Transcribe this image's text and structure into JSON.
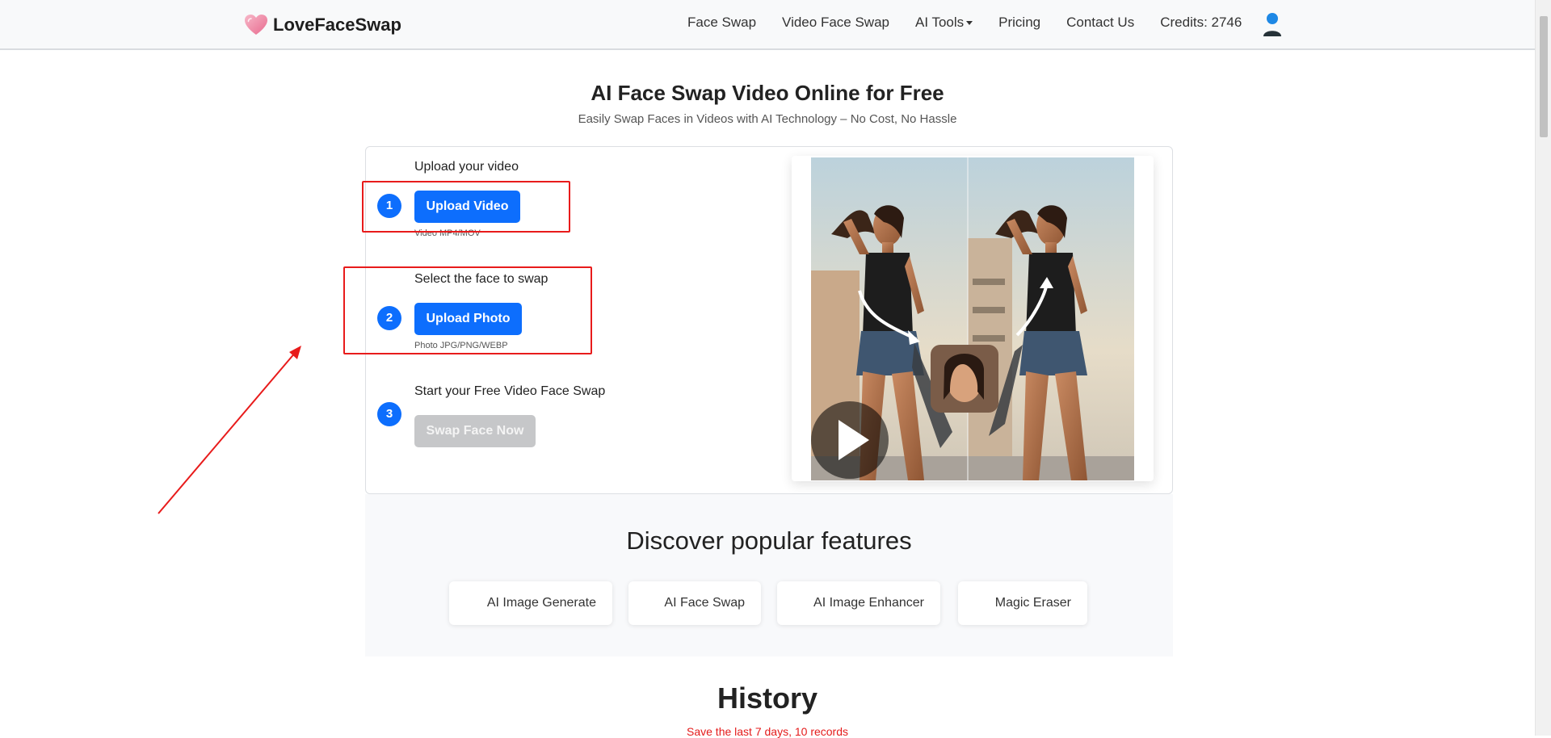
{
  "nav": {
    "brand": "LoveFaceSwap",
    "links": [
      "Face Swap",
      "Video Face Swap",
      "AI Tools",
      "Pricing",
      "Contact Us",
      "Credits: 2746"
    ],
    "user_icon": "user-icon"
  },
  "hero": {
    "title": "AI Face Swap Video Online for Free",
    "subtitle": "Easily Swap Faces in Videos with AI Technology – No Cost, No Hassle"
  },
  "steps": [
    {
      "number": "1",
      "label": "Upload your video",
      "button": "Upload Video",
      "hint": "Video MP4/MOV"
    },
    {
      "number": "2",
      "label": "Select the face to swap",
      "button": "Upload Photo",
      "hint": "Photo JPG/PNG/WEBP"
    },
    {
      "number": "3",
      "label": "Start your Free Video Face Swap",
      "button": "Swap Face Now"
    }
  ],
  "discover": {
    "title": "Discover popular features",
    "features": [
      "AI Image Generate",
      "AI Face Swap",
      "AI Image Enhancer",
      "Magic Eraser"
    ]
  },
  "history": {
    "title": "History",
    "subtitle": "Save the last 7 days, 10 records"
  },
  "colors": {
    "primary": "#0d6efd",
    "annotation_red": "#e81b1b",
    "brand_heart": "#f48fb1"
  }
}
